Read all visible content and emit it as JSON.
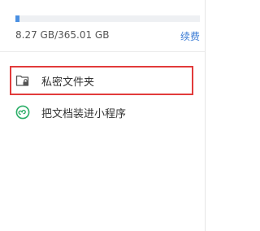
{
  "storage": {
    "used_text": "8.27 GB/365.01 GB",
    "used_fraction": 0.0227,
    "renew_label": "续费",
    "accent_color": "#4a90e2"
  },
  "menu": {
    "items": [
      {
        "icon": "locked-folder-icon",
        "label": "私密文件夹",
        "highlighted": true
      },
      {
        "icon": "mini-program-icon",
        "label": "把文档装进小程序",
        "highlighted": false
      }
    ]
  },
  "colors": {
    "highlight_border": "#e23b3b",
    "link": "#3a7bd5",
    "mini_program_green": "#2aae67"
  }
}
